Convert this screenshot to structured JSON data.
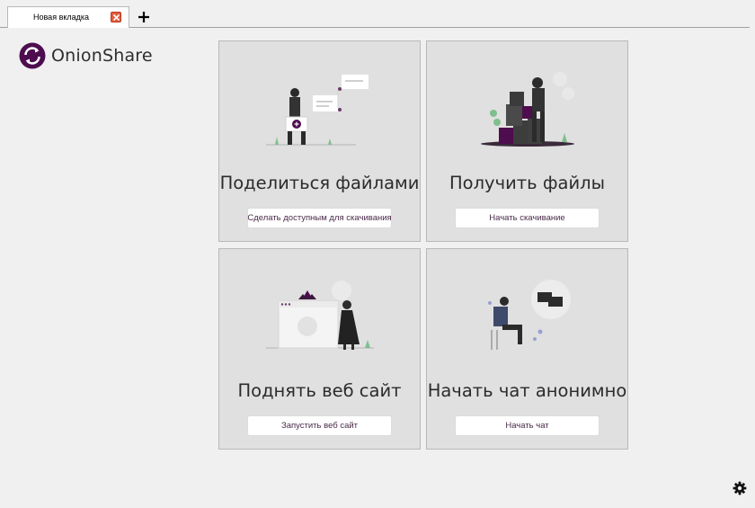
{
  "tabs": [
    {
      "label": "Новая вкладка"
    }
  ],
  "app": {
    "name": "OnionShare"
  },
  "cards": {
    "share": {
      "title": "Поделиться файлами",
      "button": "Сделать доступным для скачивания"
    },
    "receive": {
      "title": "Получить файлы",
      "button": "Начать скачивание"
    },
    "website": {
      "title": "Поднять веб сайт",
      "button": "Запустить веб сайт"
    },
    "chat": {
      "title": "Начать чат анонимно",
      "button": "Начать чат"
    }
  },
  "colors": {
    "brand": "#4e0d4e",
    "background": "#f0f0f0",
    "card": "#e0e0e0",
    "close": "#e25d3f"
  },
  "icons": [
    "onionshare-logo-icon",
    "close-tab-icon",
    "plus-icon",
    "gear-icon"
  ]
}
